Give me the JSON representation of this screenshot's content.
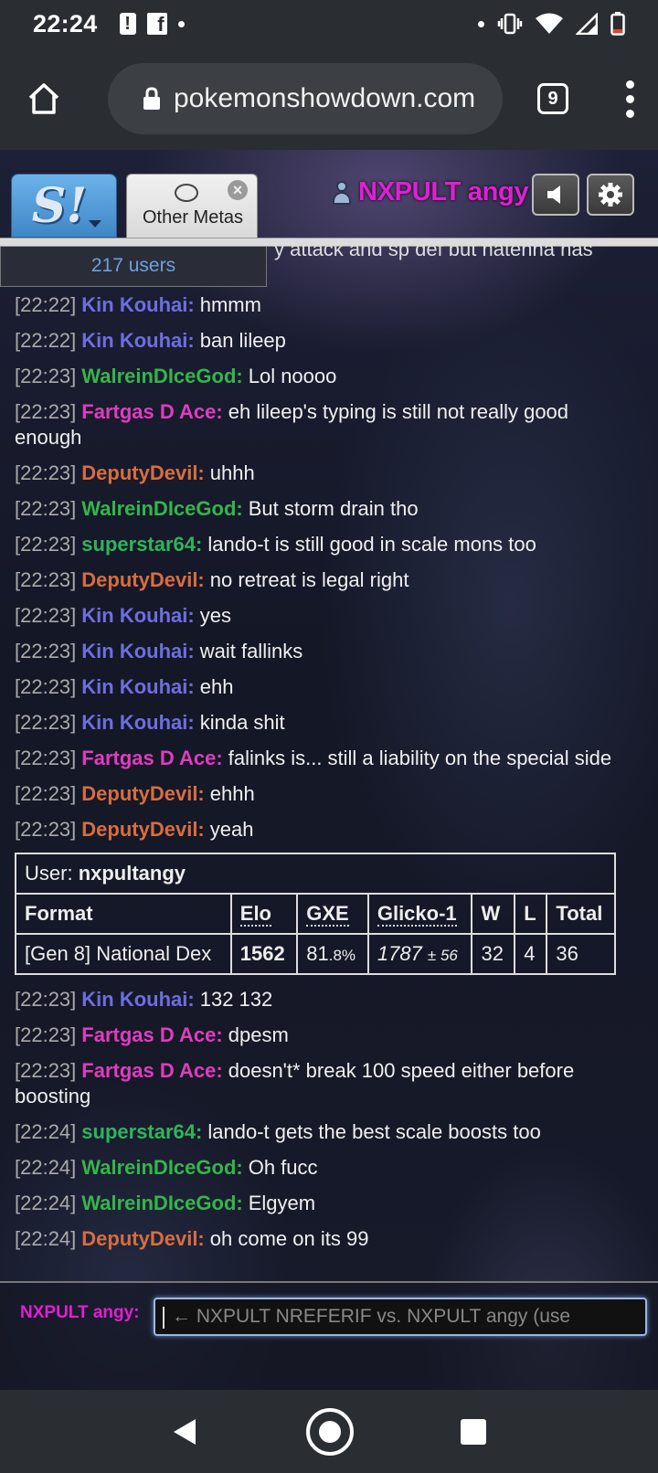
{
  "status_bar": {
    "time": "22:24"
  },
  "browser": {
    "url": "pokemonshowdown.com",
    "tab_count": "9"
  },
  "header": {
    "logo": "S!",
    "room_tab_label": "Other Metas",
    "username": "NXPULT angy"
  },
  "room": {
    "user_count": "217 users",
    "cutoff_text": "y attack and sp def but hatenna has"
  },
  "colors": {
    "kin": "#6e6ee0",
    "walrein": "#35b54a",
    "fartgas": "#e03cbf",
    "deputy": "#d86d3f",
    "superstar": "#2fb45b",
    "own_name": "#e11fd4"
  },
  "messages_before": [
    {
      "ts": "[22:22]",
      "user": "Kin Kouhai:",
      "text": "hmmm",
      "color": "kin"
    },
    {
      "ts": "[22:22]",
      "user": "Kin Kouhai:",
      "text": "ban lileep",
      "color": "kin"
    },
    {
      "ts": "[22:23]",
      "user": "WalreinDIceGod:",
      "text": "Lol noooo",
      "color": "wal"
    },
    {
      "ts": "[22:23]",
      "user": "Fartgas D Ace:",
      "text": "eh lileep's typing is still not really good enough",
      "color": "far"
    },
    {
      "ts": "[22:23]",
      "user": "DeputyDevil:",
      "text": "uhhh",
      "color": "dep"
    },
    {
      "ts": "[22:23]",
      "user": "WalreinDIceGod:",
      "text": "But storm drain tho",
      "color": "wal"
    },
    {
      "ts": "[22:23]",
      "user": "superstar64:",
      "text": "lando-t is still good in scale mons too",
      "color": "sup"
    },
    {
      "ts": "[22:23]",
      "user": "DeputyDevil:",
      "text": "no retreat is legal right",
      "color": "dep"
    },
    {
      "ts": "[22:23]",
      "user": "Kin Kouhai:",
      "text": "yes",
      "color": "kin"
    },
    {
      "ts": "[22:23]",
      "user": "Kin Kouhai:",
      "text": "wait fallinks",
      "color": "kin"
    },
    {
      "ts": "[22:23]",
      "user": "Kin Kouhai:",
      "text": "ehh",
      "color": "kin"
    },
    {
      "ts": "[22:23]",
      "user": "Kin Kouhai:",
      "text": "kinda shit",
      "color": "kin"
    },
    {
      "ts": "[22:23]",
      "user": "Fartgas D Ace:",
      "text": "falinks is... still a liability on the special side",
      "color": "far"
    },
    {
      "ts": "[22:23]",
      "user": "DeputyDevil:",
      "text": "ehhh",
      "color": "dep"
    },
    {
      "ts": "[22:23]",
      "user": "DeputyDevil:",
      "text": "yeah",
      "color": "dep"
    }
  ],
  "rank_table": {
    "user_label": "User:",
    "user_name": "nxpultangy",
    "headers": [
      "Format",
      "Elo",
      "GXE",
      "Glicko-1",
      "W",
      "L",
      "Total"
    ],
    "row": {
      "format": "[Gen 8] National Dex",
      "elo": "1562",
      "gxe_main": "81",
      "gxe_small": ".8%",
      "glicko_main": "1787",
      "glicko_small": "± 56",
      "w": "32",
      "l": "4",
      "total": "36"
    }
  },
  "messages_after": [
    {
      "ts": "[22:23]",
      "user": "Kin Kouhai:",
      "text": "132 132",
      "color": "kin"
    },
    {
      "ts": "[22:23]",
      "user": "Fartgas D Ace:",
      "text": "dpesm",
      "color": "far"
    },
    {
      "ts": "[22:23]",
      "user": "Fartgas D Ace:",
      "text": "doesn't* break 100 speed either before boosting",
      "color": "far"
    },
    {
      "ts": "[22:24]",
      "user": "superstar64:",
      "text": "lando-t gets the best scale boosts too",
      "color": "sup"
    },
    {
      "ts": "[22:24]",
      "user": "WalreinDIceGod:",
      "text": "Oh fucc",
      "color": "wal"
    },
    {
      "ts": "[22:24]",
      "user": "WalreinDIceGod:",
      "text": "Elgyem",
      "color": "wal"
    },
    {
      "ts": "[22:24]",
      "user": "DeputyDevil:",
      "text": "oh come on its 99",
      "color": "dep"
    }
  ],
  "chatbox": {
    "label": "NXPULT angy:",
    "placeholder": "← NXPULT NREFERIF vs. NXPULT angy (use"
  }
}
